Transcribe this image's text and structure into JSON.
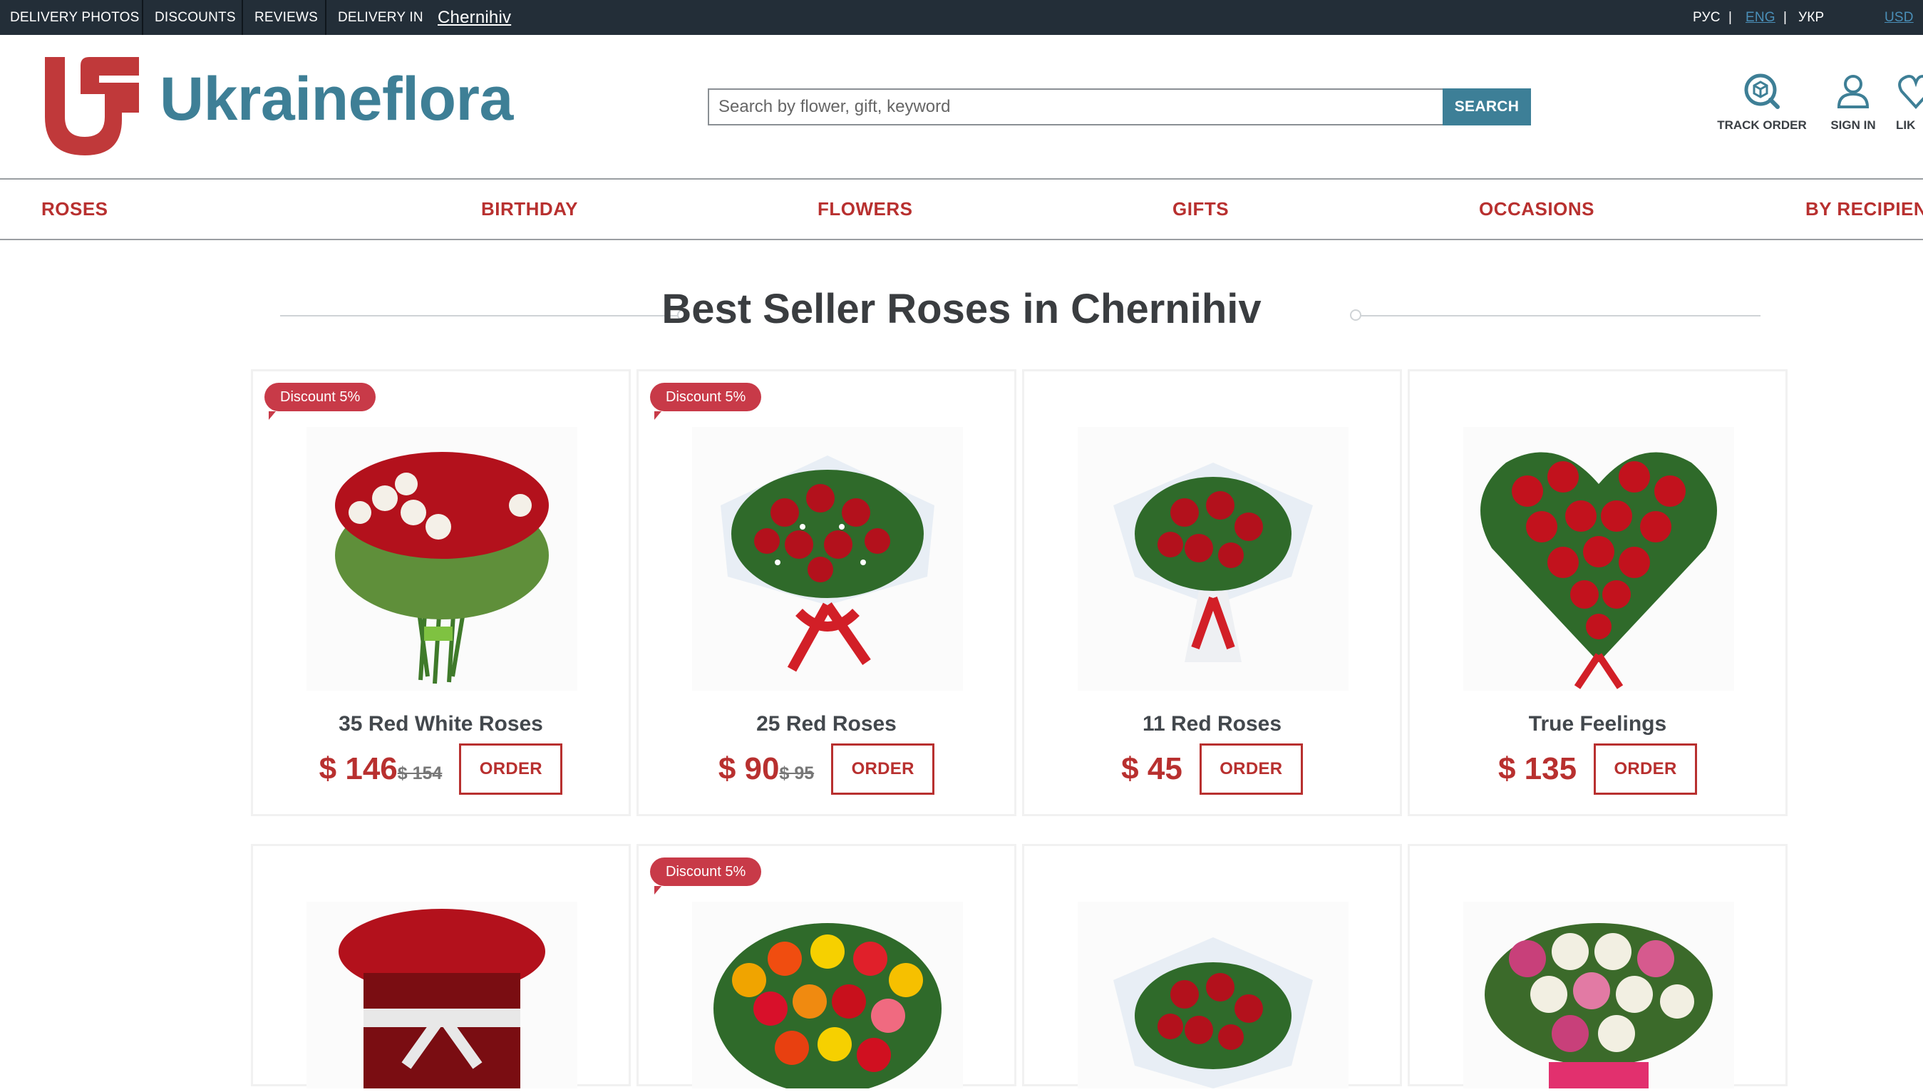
{
  "topbar": {
    "delivery_photos": "DELIVERY PHOTOS",
    "discounts": "DISCOUNTS",
    "reviews": "REVIEWS",
    "delivery_in": "DELIVERY IN",
    "city": "Chernihiv",
    "lang_ru": "РУС",
    "lang_en": "ENG",
    "lang_ua": "УКР",
    "divider": "|",
    "currency": "USD"
  },
  "header": {
    "logo_text": "Ukraineflora",
    "search_placeholder": "Search by flower, gift, keyword",
    "search_button": "SEARCH",
    "track_order": "TRACK ORDER",
    "sign_in": "SIGN IN",
    "likes": "LIK"
  },
  "nav": {
    "items": [
      "ROSES",
      "BIRTHDAY",
      "FLOWERS",
      "GIFTS",
      "OCCASIONS",
      "BY RECIPIEN"
    ]
  },
  "section": {
    "title": "Best Seller Roses in Chernihiv"
  },
  "products": [
    {
      "name": "35 Red White Roses",
      "price": "$ 146",
      "old_price": "$ 154",
      "badge": "Discount 5%",
      "order": "ORDER"
    },
    {
      "name": "25 Red Roses",
      "price": "$ 90",
      "old_price": "$ 95",
      "badge": "Discount 5%",
      "order": "ORDER"
    },
    {
      "name": "11 Red Roses",
      "price": "$ 45",
      "old_price": "",
      "badge": "",
      "order": "ORDER"
    },
    {
      "name": "True Feelings",
      "price": "$ 135",
      "old_price": "",
      "badge": "",
      "order": "ORDER"
    },
    {
      "name": "",
      "price": "",
      "old_price": "",
      "badge": "",
      "order": ""
    },
    {
      "name": "",
      "price": "",
      "old_price": "",
      "badge": "Discount 5%",
      "order": ""
    },
    {
      "name": "",
      "price": "",
      "old_price": "",
      "badge": "",
      "order": ""
    },
    {
      "name": "",
      "price": "",
      "old_price": "",
      "badge": "",
      "order": ""
    }
  ],
  "colors": {
    "brand_red": "#b8302f",
    "brand_teal": "#3e7f96",
    "topbar_bg": "#232e38",
    "badge": "#c83a48"
  },
  "icons": {
    "track_order": "box-search-icon",
    "sign_in": "user-icon",
    "likes": "heart-icon"
  }
}
